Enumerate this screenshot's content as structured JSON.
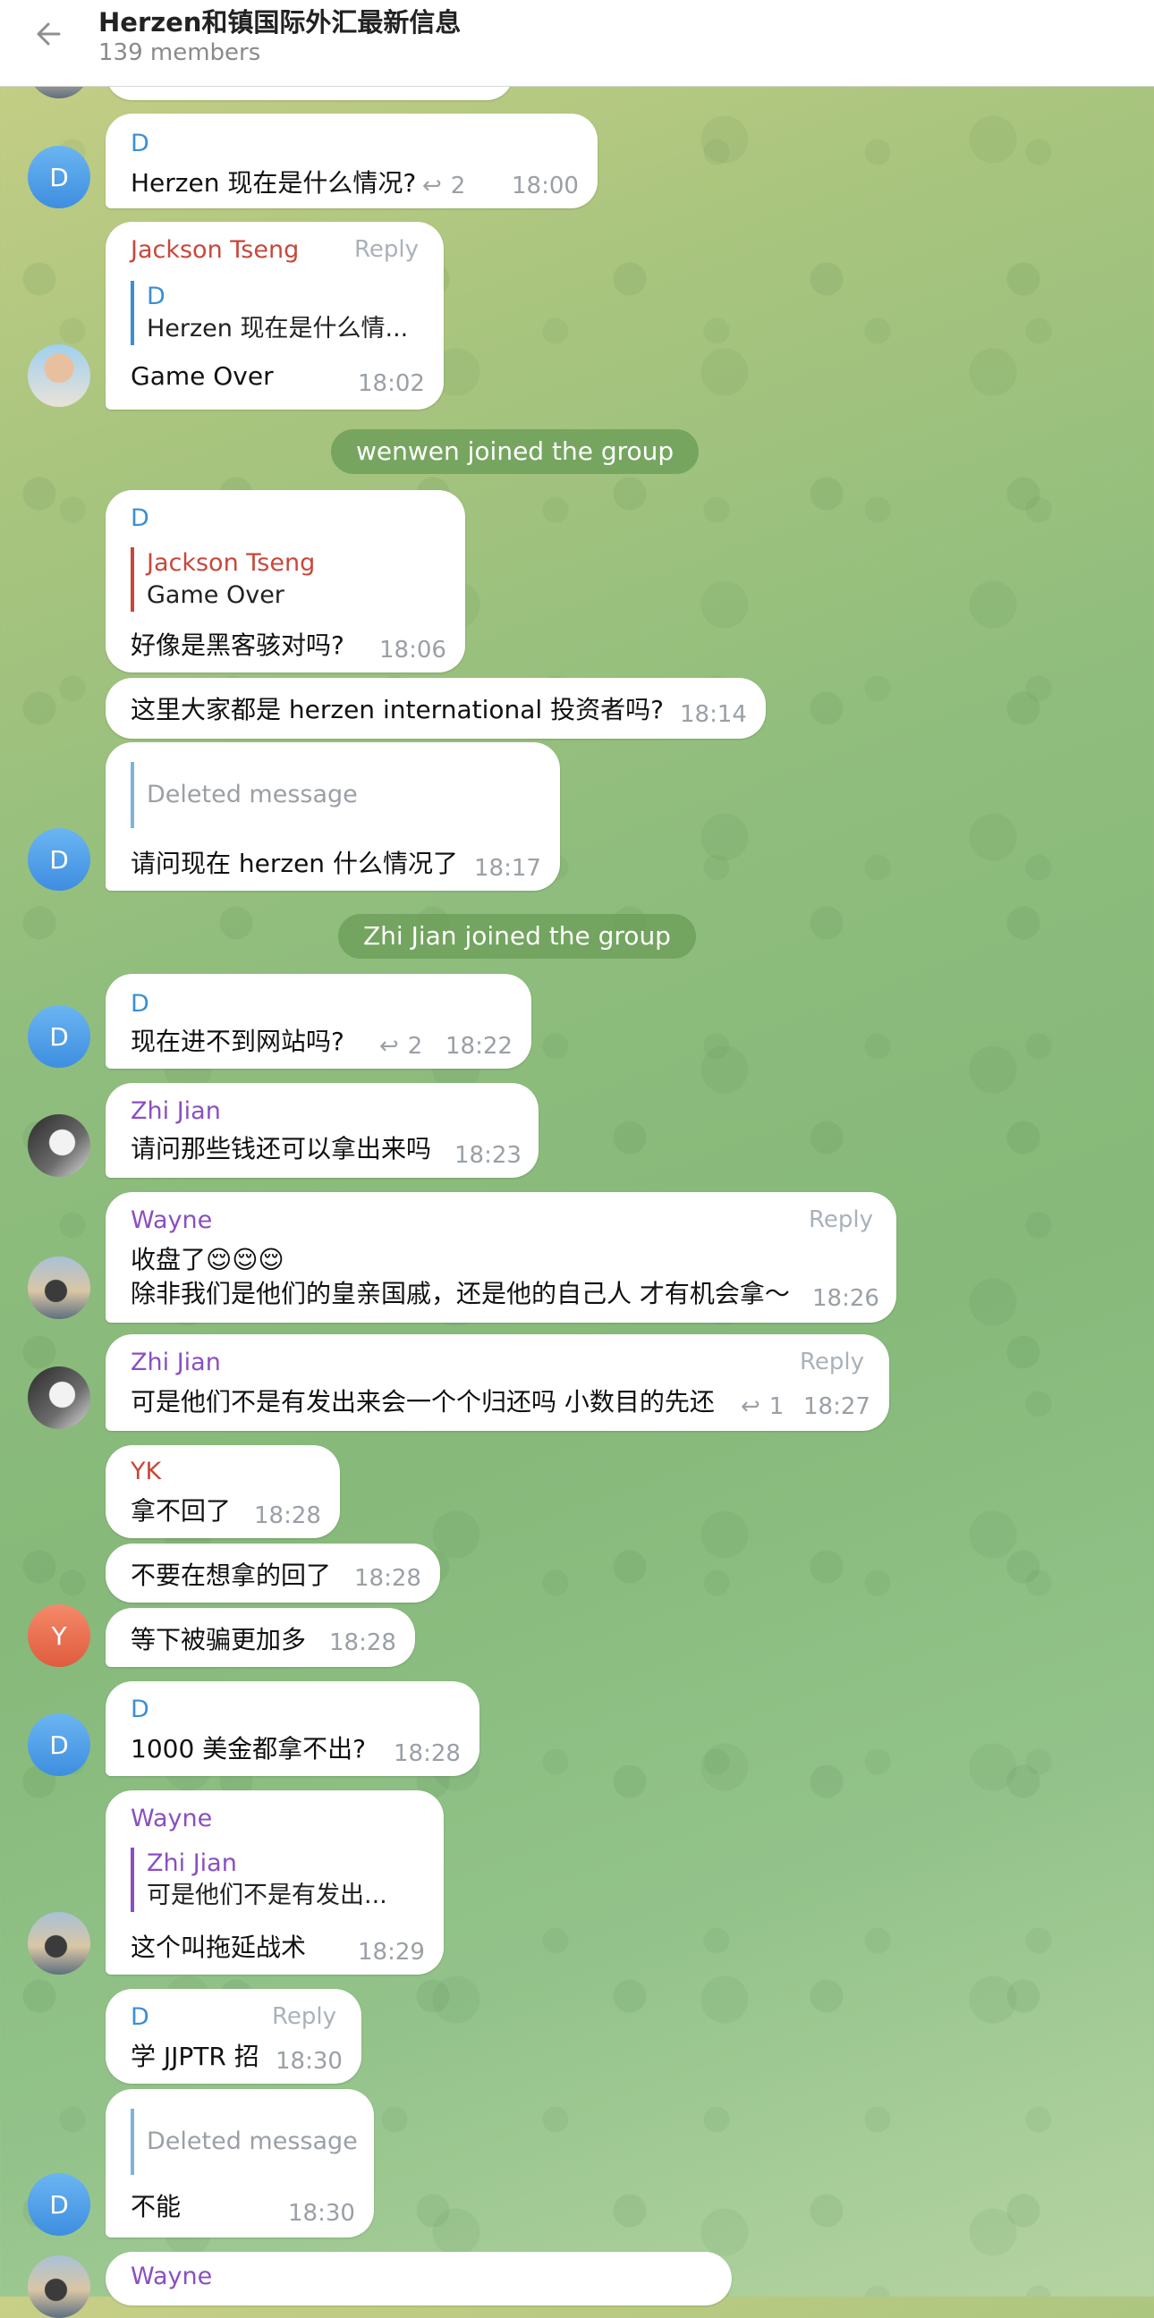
{
  "header": {
    "title": "Herzen和镇国际外汇最新信息",
    "members": "139 members"
  },
  "colors": {
    "accent": "#3a8fd4",
    "jackson": "#c8473b",
    "purple": "#8a4fc2"
  },
  "system": {
    "wenwen_joined": "wenwen joined the group",
    "zhijian_joined": "Zhi Jian joined the group"
  },
  "avatar_letters": {
    "d": "D",
    "y": "Y"
  },
  "messages": {
    "m1": {
      "sender": "D",
      "text": "Herzen 现在是什么情况?",
      "replies": "2",
      "time": "18:00"
    },
    "m2": {
      "sender": "Jackson Tseng",
      "reply_link": "Reply",
      "quote_name": "D",
      "quote_text": "Herzen 现在是什么情...",
      "text": "Game Over",
      "time": "18:02"
    },
    "m3": {
      "sender": "D",
      "quote_name": "Jackson Tseng",
      "quote_text": "Game Over",
      "text": "好像是黑客骇对吗?",
      "time": "18:06"
    },
    "m4": {
      "text": "这里大家都是 herzen international 投资者吗?",
      "time": "18:14"
    },
    "m5": {
      "quote_deleted": "Deleted message",
      "text": "请问现在 herzen 什么情况了",
      "time": "18:17"
    },
    "m6": {
      "sender": "D",
      "text": "现在进不到网站吗?",
      "replies": "2",
      "time": "18:22"
    },
    "m7": {
      "sender": "Zhi Jian",
      "text": "请问那些钱还可以拿出来吗",
      "time": "18:23"
    },
    "m8": {
      "sender": "Wayne",
      "reply_link": "Reply",
      "text1": "收盘了😌😌😌",
      "text2": "除非我们是他们的皇亲国戚，还是他的自己人 才有机会拿～",
      "time": "18:26"
    },
    "m9": {
      "sender": "Zhi Jian",
      "reply_link": "Reply",
      "text": "可是他们不是有发出来会一个个归还吗 小数目的先还",
      "replies": "1",
      "time": "18:27"
    },
    "m10": {
      "sender": "YK",
      "text": "拿不回了",
      "time": "18:28"
    },
    "m11": {
      "text": "不要在想拿的回了",
      "time": "18:28"
    },
    "m12": {
      "text": "等下被骗更加多",
      "time": "18:28"
    },
    "m13": {
      "sender": "D",
      "text": "1000 美金都拿不出?",
      "time": "18:28"
    },
    "m14": {
      "sender": "Wayne",
      "quote_name": "Zhi Jian",
      "quote_text": "可是他们不是有发出...",
      "text": "这个叫拖延战术",
      "time": "18:29"
    },
    "m15": {
      "sender": "D",
      "reply_link": "Reply",
      "text": "学 JJPTR 招",
      "time": "18:30"
    },
    "m16": {
      "quote_deleted": "Deleted message",
      "text": "不能",
      "time": "18:30"
    },
    "m17": {
      "sender": "Wayne"
    }
  }
}
